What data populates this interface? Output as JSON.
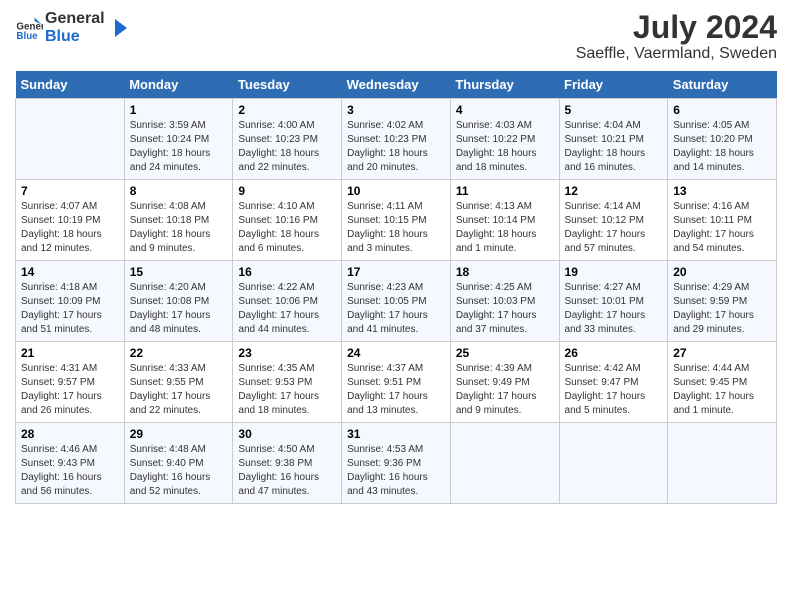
{
  "header": {
    "logo_line1": "General",
    "logo_line2": "Blue",
    "month_year": "July 2024",
    "location": "Saeffle, Vaermland, Sweden"
  },
  "weekdays": [
    "Sunday",
    "Monday",
    "Tuesday",
    "Wednesday",
    "Thursday",
    "Friday",
    "Saturday"
  ],
  "weeks": [
    [
      {
        "day": "",
        "info": ""
      },
      {
        "day": "1",
        "info": "Sunrise: 3:59 AM\nSunset: 10:24 PM\nDaylight: 18 hours\nand 24 minutes."
      },
      {
        "day": "2",
        "info": "Sunrise: 4:00 AM\nSunset: 10:23 PM\nDaylight: 18 hours\nand 22 minutes."
      },
      {
        "day": "3",
        "info": "Sunrise: 4:02 AM\nSunset: 10:23 PM\nDaylight: 18 hours\nand 20 minutes."
      },
      {
        "day": "4",
        "info": "Sunrise: 4:03 AM\nSunset: 10:22 PM\nDaylight: 18 hours\nand 18 minutes."
      },
      {
        "day": "5",
        "info": "Sunrise: 4:04 AM\nSunset: 10:21 PM\nDaylight: 18 hours\nand 16 minutes."
      },
      {
        "day": "6",
        "info": "Sunrise: 4:05 AM\nSunset: 10:20 PM\nDaylight: 18 hours\nand 14 minutes."
      }
    ],
    [
      {
        "day": "7",
        "info": "Sunrise: 4:07 AM\nSunset: 10:19 PM\nDaylight: 18 hours\nand 12 minutes."
      },
      {
        "day": "8",
        "info": "Sunrise: 4:08 AM\nSunset: 10:18 PM\nDaylight: 18 hours\nand 9 minutes."
      },
      {
        "day": "9",
        "info": "Sunrise: 4:10 AM\nSunset: 10:16 PM\nDaylight: 18 hours\nand 6 minutes."
      },
      {
        "day": "10",
        "info": "Sunrise: 4:11 AM\nSunset: 10:15 PM\nDaylight: 18 hours\nand 3 minutes."
      },
      {
        "day": "11",
        "info": "Sunrise: 4:13 AM\nSunset: 10:14 PM\nDaylight: 18 hours\nand 1 minute."
      },
      {
        "day": "12",
        "info": "Sunrise: 4:14 AM\nSunset: 10:12 PM\nDaylight: 17 hours\nand 57 minutes."
      },
      {
        "day": "13",
        "info": "Sunrise: 4:16 AM\nSunset: 10:11 PM\nDaylight: 17 hours\nand 54 minutes."
      }
    ],
    [
      {
        "day": "14",
        "info": "Sunrise: 4:18 AM\nSunset: 10:09 PM\nDaylight: 17 hours\nand 51 minutes."
      },
      {
        "day": "15",
        "info": "Sunrise: 4:20 AM\nSunset: 10:08 PM\nDaylight: 17 hours\nand 48 minutes."
      },
      {
        "day": "16",
        "info": "Sunrise: 4:22 AM\nSunset: 10:06 PM\nDaylight: 17 hours\nand 44 minutes."
      },
      {
        "day": "17",
        "info": "Sunrise: 4:23 AM\nSunset: 10:05 PM\nDaylight: 17 hours\nand 41 minutes."
      },
      {
        "day": "18",
        "info": "Sunrise: 4:25 AM\nSunset: 10:03 PM\nDaylight: 17 hours\nand 37 minutes."
      },
      {
        "day": "19",
        "info": "Sunrise: 4:27 AM\nSunset: 10:01 PM\nDaylight: 17 hours\nand 33 minutes."
      },
      {
        "day": "20",
        "info": "Sunrise: 4:29 AM\nSunset: 9:59 PM\nDaylight: 17 hours\nand 29 minutes."
      }
    ],
    [
      {
        "day": "21",
        "info": "Sunrise: 4:31 AM\nSunset: 9:57 PM\nDaylight: 17 hours\nand 26 minutes."
      },
      {
        "day": "22",
        "info": "Sunrise: 4:33 AM\nSunset: 9:55 PM\nDaylight: 17 hours\nand 22 minutes."
      },
      {
        "day": "23",
        "info": "Sunrise: 4:35 AM\nSunset: 9:53 PM\nDaylight: 17 hours\nand 18 minutes."
      },
      {
        "day": "24",
        "info": "Sunrise: 4:37 AM\nSunset: 9:51 PM\nDaylight: 17 hours\nand 13 minutes."
      },
      {
        "day": "25",
        "info": "Sunrise: 4:39 AM\nSunset: 9:49 PM\nDaylight: 17 hours\nand 9 minutes."
      },
      {
        "day": "26",
        "info": "Sunrise: 4:42 AM\nSunset: 9:47 PM\nDaylight: 17 hours\nand 5 minutes."
      },
      {
        "day": "27",
        "info": "Sunrise: 4:44 AM\nSunset: 9:45 PM\nDaylight: 17 hours\nand 1 minute."
      }
    ],
    [
      {
        "day": "28",
        "info": "Sunrise: 4:46 AM\nSunset: 9:43 PM\nDaylight: 16 hours\nand 56 minutes."
      },
      {
        "day": "29",
        "info": "Sunrise: 4:48 AM\nSunset: 9:40 PM\nDaylight: 16 hours\nand 52 minutes."
      },
      {
        "day": "30",
        "info": "Sunrise: 4:50 AM\nSunset: 9:38 PM\nDaylight: 16 hours\nand 47 minutes."
      },
      {
        "day": "31",
        "info": "Sunrise: 4:53 AM\nSunset: 9:36 PM\nDaylight: 16 hours\nand 43 minutes."
      },
      {
        "day": "",
        "info": ""
      },
      {
        "day": "",
        "info": ""
      },
      {
        "day": "",
        "info": ""
      }
    ]
  ]
}
